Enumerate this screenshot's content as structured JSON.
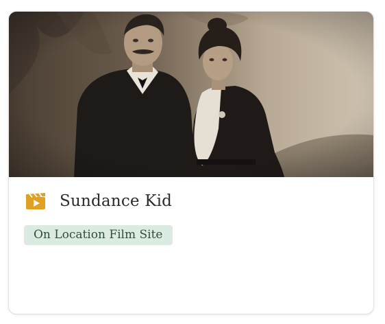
{
  "card": {
    "title": "Sundance Kid",
    "icon": "film-clapper-icon",
    "icon_color": "#e0a024",
    "tag": {
      "label": "On Location Film Site",
      "background": "#dcebe2",
      "text_color": "#2f4d3a"
    },
    "image": {
      "icon": "sepia-portrait-photo"
    }
  }
}
